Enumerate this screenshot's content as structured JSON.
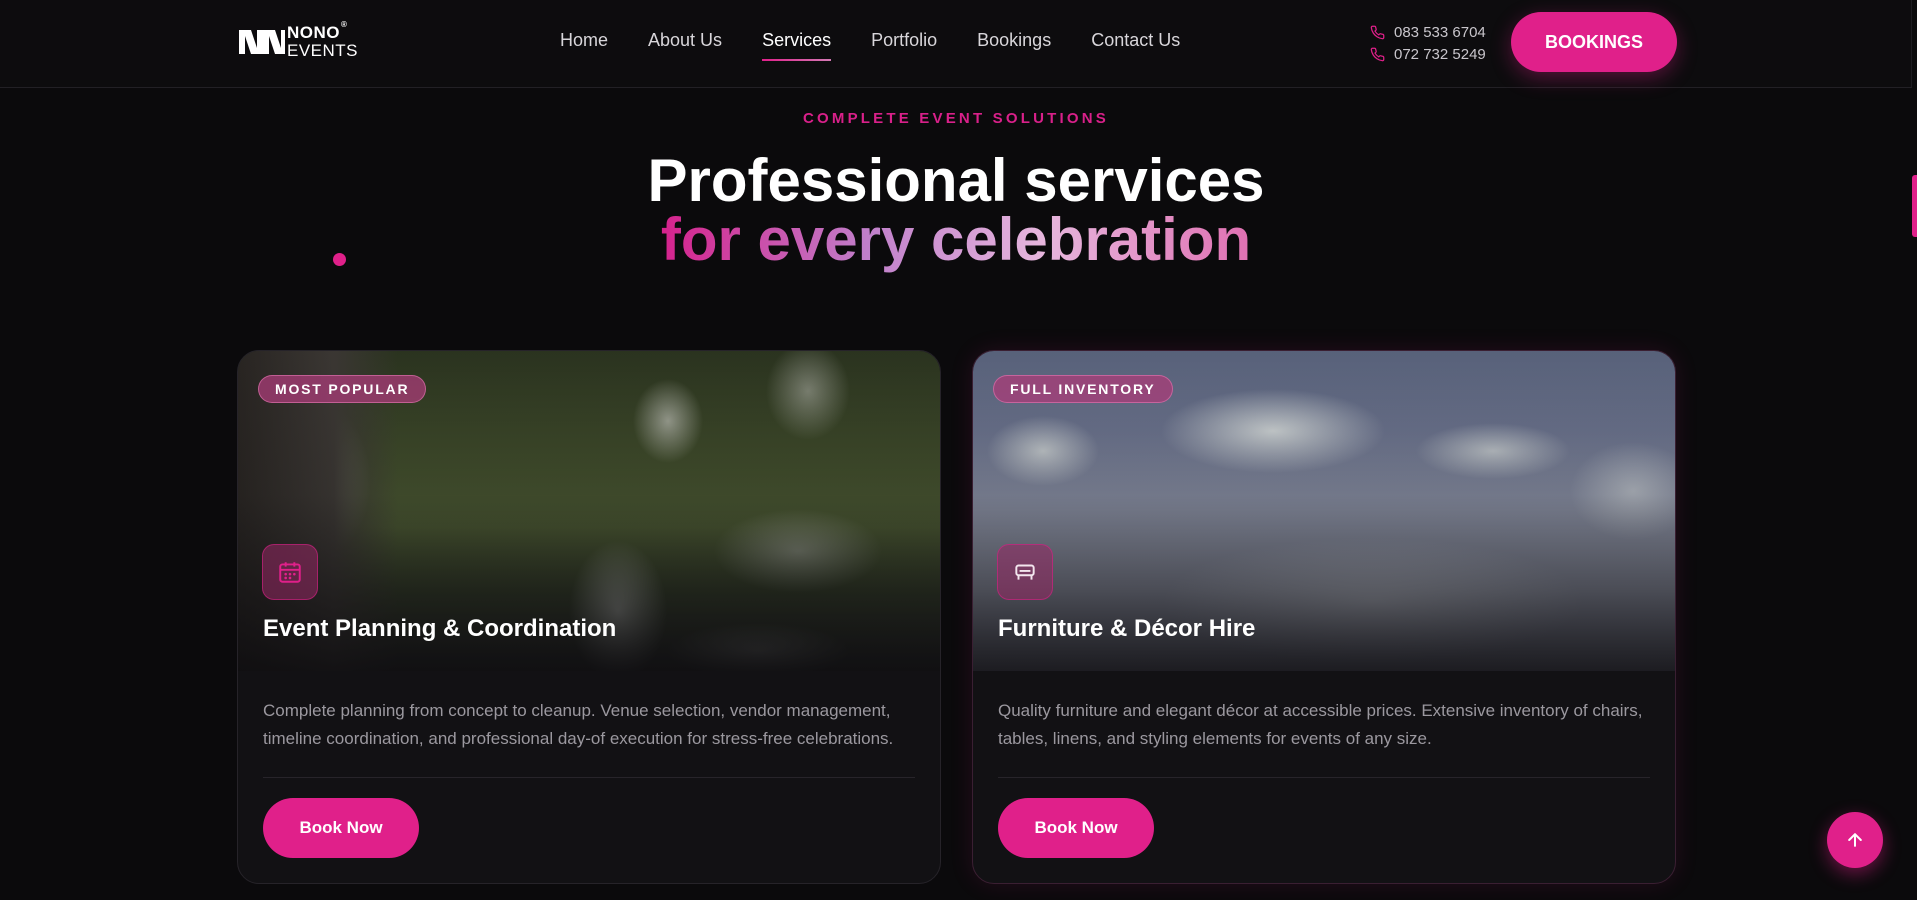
{
  "brand": {
    "name_top": "NONO",
    "registered": "®",
    "name_bottom": "EVENTS"
  },
  "nav": {
    "items": [
      "Home",
      "About Us",
      "Services",
      "Portfolio",
      "Bookings",
      "Contact Us"
    ],
    "active": "Services"
  },
  "contact": {
    "phone_1": "083 533 6704",
    "phone_2": "072 732 5249"
  },
  "header_cta": "BOOKINGS",
  "hero": {
    "eyebrow": "COMPLETE EVENT SOLUTIONS",
    "title_line1": "Professional services",
    "title_line2": "for every celebration"
  },
  "cards": [
    {
      "badge": "MOST POPULAR",
      "icon": "calendar-icon",
      "title": "Event Planning & Coordination",
      "description": "Complete planning from concept to cleanup. Venue selection, vendor management, timeline coordination, and professional day-of execution for stress-free celebrations.",
      "cta": "Book Now"
    },
    {
      "badge": "FULL INVENTORY",
      "icon": "sofa-icon",
      "title": "Furniture & Décor Hire",
      "description": "Quality furniture and elegant décor at accessible prices. Extensive inventory of chairs, tables, linens, and styling elements for events of any size.",
      "cta": "Book Now"
    }
  ],
  "colors": {
    "accent": "#e0208a",
    "background": "#0b0a0c",
    "card": "#121114"
  }
}
